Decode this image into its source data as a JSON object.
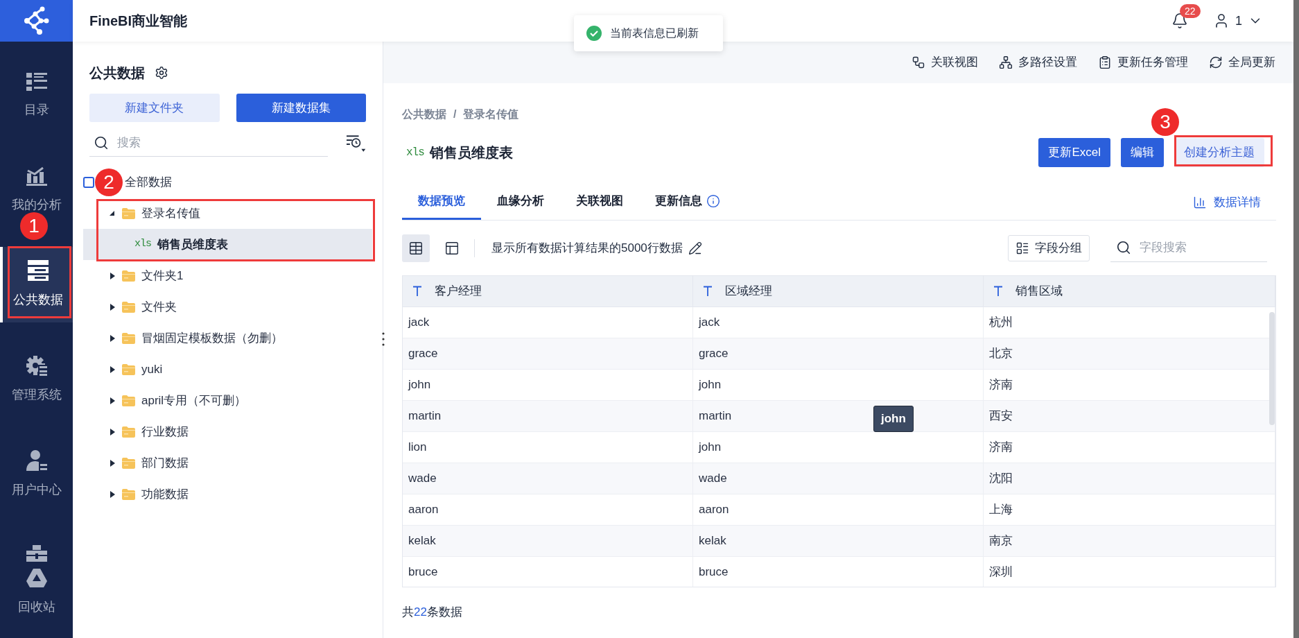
{
  "app": {
    "title": "FineBI商业智能"
  },
  "header": {
    "notifications": "22",
    "user": "1"
  },
  "toast": {
    "message": "当前表信息已刷新"
  },
  "sidebar": {
    "items": [
      {
        "label": "目录",
        "kind": "catalog",
        "selected": false
      },
      {
        "label": "我的分析",
        "kind": "analysis",
        "selected": false
      },
      {
        "label": "公共数据",
        "kind": "public-data",
        "selected": true
      },
      {
        "label": "管理系统",
        "kind": "admin",
        "selected": false
      },
      {
        "label": "用户中心",
        "kind": "user-center",
        "selected": false
      },
      {
        "label": "回收站",
        "kind": "recycle",
        "selected": false
      }
    ]
  },
  "left_panel": {
    "title": "公共数据",
    "buttons": [
      {
        "label": "新建文件夹",
        "kind": "secondary"
      },
      {
        "label": "新建数据集",
        "kind": "primary"
      }
    ],
    "search": {
      "placeholder": "搜索"
    },
    "tree": {
      "label": "全部数据",
      "children": [
        {
          "label": "登录名传值",
          "kind": "folder",
          "expanded": true,
          "selected": false,
          "children": [
            {
              "label": "销售员维度表",
              "kind": "table",
              "file_type": "xls",
              "selected": true
            }
          ]
        },
        {
          "label": "文件夹1",
          "kind": "folder",
          "expanded": false,
          "selected": false
        },
        {
          "label": "文件夹",
          "kind": "folder",
          "expanded": false,
          "selected": false
        },
        {
          "label": "冒烟固定模板数据（勿删）",
          "kind": "folder",
          "expanded": false,
          "selected": false
        },
        {
          "label": "yuki",
          "kind": "folder",
          "expanded": false,
          "selected": false
        },
        {
          "label": "april专用（不可删）",
          "kind": "folder",
          "expanded": false,
          "selected": false
        },
        {
          "label": "行业数据",
          "kind": "folder",
          "expanded": false,
          "selected": false
        },
        {
          "label": "部门数据",
          "kind": "folder",
          "expanded": false,
          "selected": false
        },
        {
          "label": "功能数据",
          "kind": "folder",
          "expanded": false,
          "selected": false
        }
      ]
    }
  },
  "toolbar": [
    {
      "label": "关联视图",
      "kind": "relation"
    },
    {
      "label": "多路径设置",
      "kind": "multipath"
    },
    {
      "label": "更新任务管理",
      "kind": "tasks"
    },
    {
      "label": "全局更新",
      "kind": "global-update"
    }
  ],
  "breadcrumb": {
    "items": [
      "公共数据",
      "登录名传值"
    ],
    "separator": "/"
  },
  "dataset": {
    "title": "销售员维度表",
    "file_type": "xls"
  },
  "actions": [
    {
      "label": "更新Excel",
      "kind": "primary"
    },
    {
      "label": "编辑",
      "kind": "primary"
    },
    {
      "label": "创建分析主题",
      "kind": "secondary"
    }
  ],
  "tabs": [
    {
      "label": "数据预览",
      "selected": true,
      "info": false
    },
    {
      "label": "血缘分析",
      "selected": false,
      "info": false
    },
    {
      "label": "关联视图",
      "selected": false,
      "info": false
    },
    {
      "label": "更新信息",
      "selected": false,
      "info": true
    }
  ],
  "details_link": "数据详情",
  "preview": {
    "view_modes": [
      {
        "kind": "grid",
        "selected": true
      },
      {
        "kind": "layout",
        "selected": false
      }
    ],
    "note": "显示所有数据计算结果的5000行数据",
    "group_button": "字段分组",
    "field_search": {
      "placeholder": "字段搜索"
    }
  },
  "table": {
    "columns": [
      "客户经理",
      "区域经理",
      "销售区域"
    ],
    "rows": [
      [
        "jack",
        "jack",
        "杭州"
      ],
      [
        "grace",
        "grace",
        "北京"
      ],
      [
        "john",
        "john",
        "济南"
      ],
      [
        "martin",
        "martin",
        "西安"
      ],
      [
        "lion",
        "john",
        "济南"
      ],
      [
        "wade",
        "wade",
        "沈阳"
      ],
      [
        "aaron",
        "aaron",
        "上海"
      ],
      [
        "kelak",
        "kelak",
        "南京"
      ],
      [
        "bruce",
        "bruce",
        "深圳"
      ]
    ]
  },
  "tooltip": "john",
  "footer": {
    "prefix": "共",
    "count": "22",
    "suffix": "条数据"
  },
  "annotations": [
    "1",
    "2",
    "3"
  ]
}
